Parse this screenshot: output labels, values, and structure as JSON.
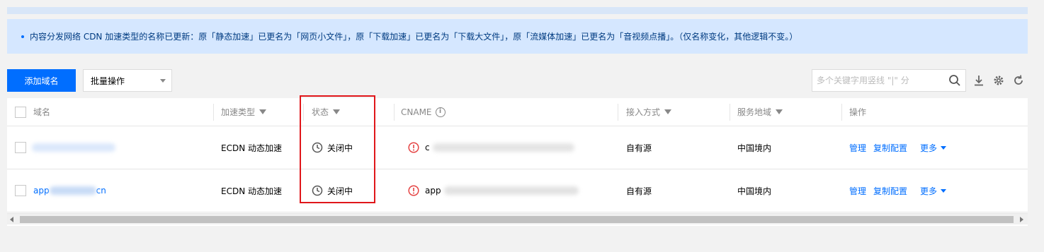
{
  "notice": {
    "text": "内容分发网络 CDN 加速类型的名称已更新：原「静态加速」已更名为「网页小文件」，原「下载加速」已更名为「下载大文件」，原「流媒体加速」已更名为「音视频点播」。（仅名称变化，其他逻辑不变。）"
  },
  "toolbar": {
    "add_domain_label": "添加域名",
    "batch_label": "批量操作",
    "search_placeholder": "多个关键字用竖线 \"|\" 分",
    "icons": [
      "download-icon",
      "gear-icon",
      "refresh-icon"
    ]
  },
  "table": {
    "headers": {
      "domain": "域名",
      "accel_type": "加速类型",
      "status": "状态",
      "cname": "CNAME",
      "access": "接入方式",
      "region": "服务地域",
      "ops": "操作"
    },
    "rows": [
      {
        "domain": "",
        "accel_type": "ECDN 动态加速",
        "status": "关闭中",
        "cname": "c",
        "access": "自有源",
        "region": "中国境内",
        "manage": "管理",
        "copy": "复制配置",
        "more": "更多"
      },
      {
        "domain": "app",
        "domain_tail": "cn",
        "accel_type": "ECDN 动态加速",
        "status": "关闭中",
        "cname": "app",
        "access": "自有源",
        "region": "中国境内",
        "manage": "管理",
        "copy": "复制配置",
        "more": "更多"
      }
    ]
  },
  "colors": {
    "primary": "#006eff",
    "highlight_border": "#e0161a",
    "warning": "#e54545",
    "notice_bg": "#d5e7ff"
  }
}
